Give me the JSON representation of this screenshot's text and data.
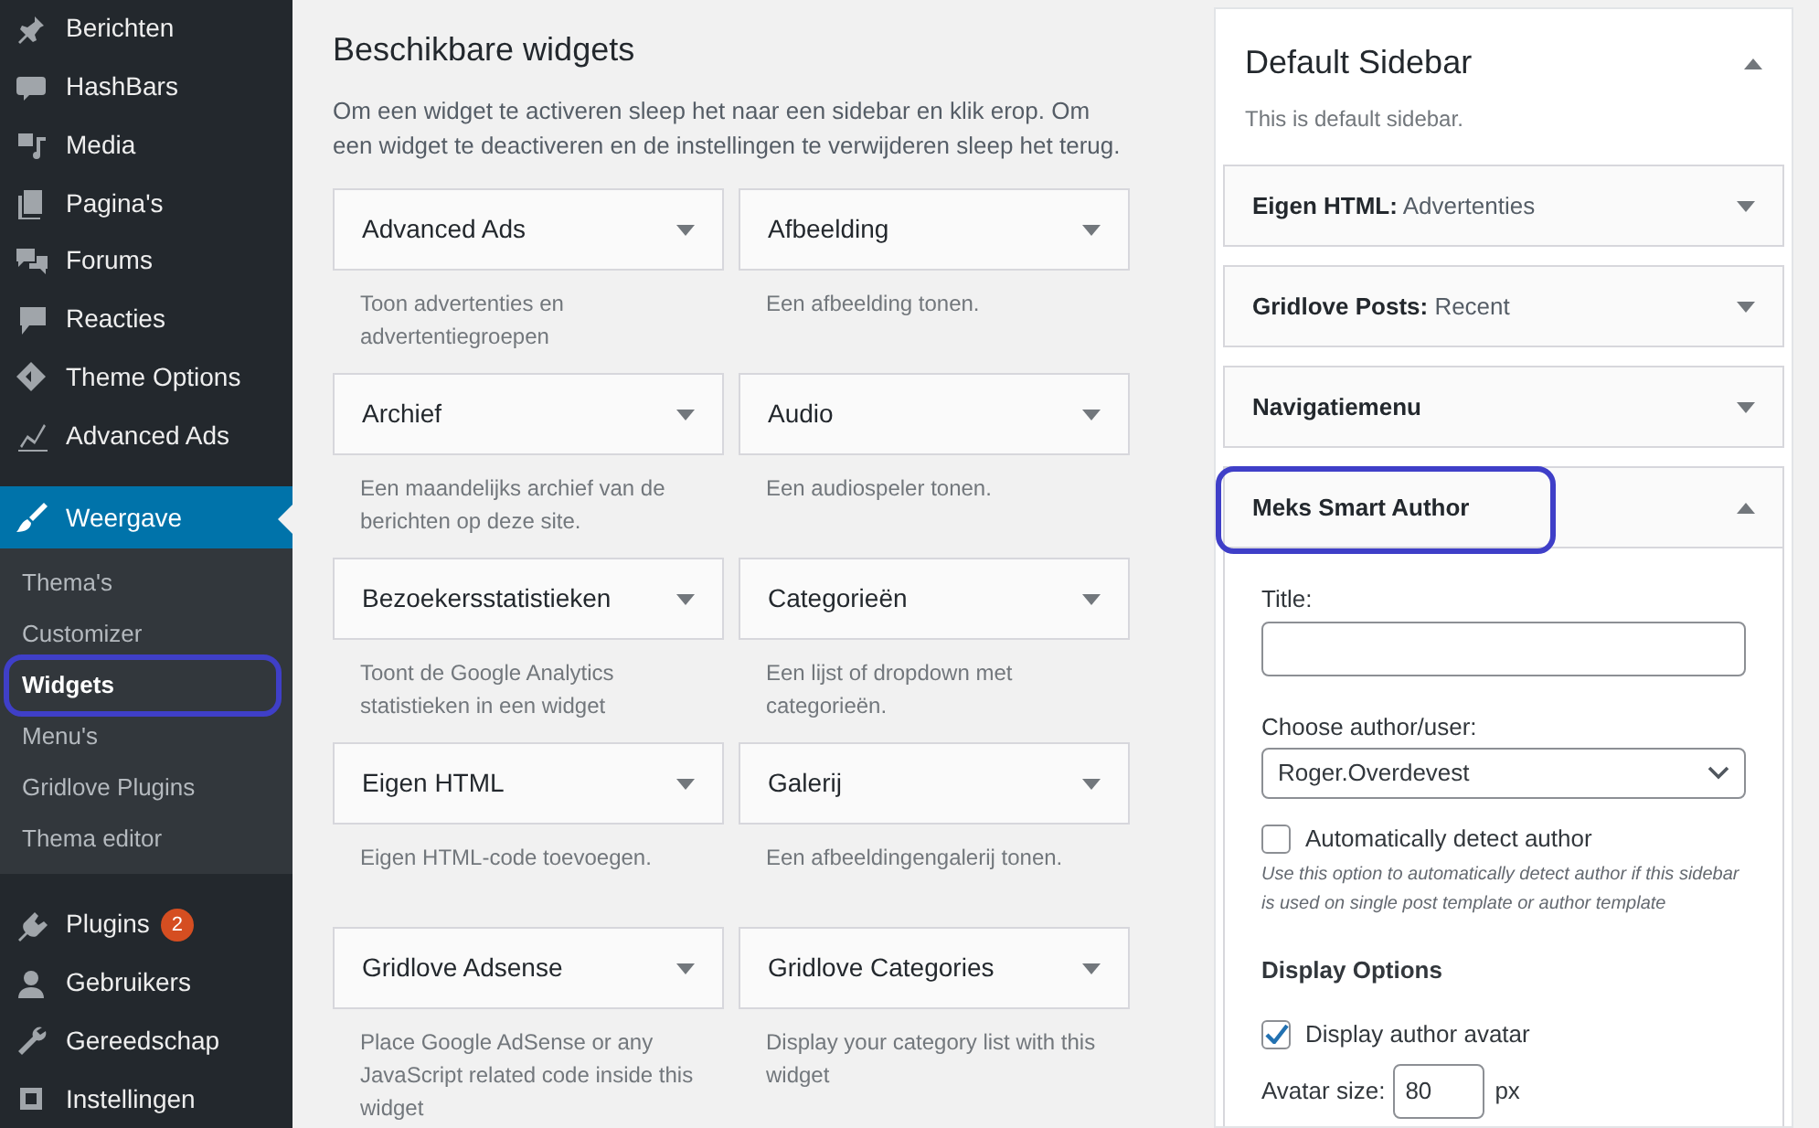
{
  "admin_menu": {
    "items": [
      {
        "label": "Berichten",
        "selected": false
      },
      {
        "label": "HashBars",
        "selected": false
      },
      {
        "label": "Media",
        "selected": false
      },
      {
        "label": "Pagina's",
        "selected": false
      },
      {
        "label": "Forums",
        "selected": false
      },
      {
        "label": "Reacties",
        "selected": false
      },
      {
        "label": "Theme Options",
        "selected": false
      },
      {
        "label": "Advanced Ads",
        "selected": false
      },
      {
        "label": "Weergave",
        "selected": true,
        "children": [
          {
            "label": "Thema's",
            "selected": false,
            "highlighted": false
          },
          {
            "label": "Customizer",
            "selected": false,
            "highlighted": false
          },
          {
            "label": "Widgets",
            "selected": true,
            "highlighted": true
          },
          {
            "label": "Menu's",
            "selected": false,
            "highlighted": false
          },
          {
            "label": "Gridlove Plugins",
            "selected": false,
            "highlighted": false
          },
          {
            "label": "Thema editor",
            "selected": false,
            "highlighted": false
          }
        ]
      },
      {
        "label": "Plugins",
        "selected": false,
        "badge": "2"
      },
      {
        "label": "Gebruikers",
        "selected": false
      },
      {
        "label": "Gereedschap",
        "selected": false
      },
      {
        "label": "Instellingen",
        "selected": false
      }
    ]
  },
  "available_widgets": {
    "title": "Beschikbare widgets",
    "description": "Om een widget te activeren sleep het naar een sidebar en klik erop. Om een widget te deactiveren en de instellingen te verwijderen sleep het terug.",
    "widgets": [
      {
        "title": "Advanced Ads",
        "description": "Toon advertenties en advertentiegroepen"
      },
      {
        "title": "Afbeelding",
        "description": "Een afbeelding tonen."
      },
      {
        "title": "Archief",
        "description": "Een maandelijks archief van de berichten op deze site."
      },
      {
        "title": "Audio",
        "description": "Een audiospeler tonen."
      },
      {
        "title": "Bezoekersstatistieken",
        "description": "Toont de Google Analytics statistieken in een widget"
      },
      {
        "title": "Categorieën",
        "description": "Een lijst of dropdown met categorieën."
      },
      {
        "title": "Eigen HTML",
        "description": "Eigen HTML-code toevoegen."
      },
      {
        "title": "Galerij",
        "description": "Een afbeeldingengalerij tonen."
      },
      {
        "title": "Gridlove Adsense",
        "description": "Place Google AdSense or any JavaScript related code inside this widget"
      },
      {
        "title": "Gridlove Categories",
        "description": "Display your category list with this widget"
      }
    ]
  },
  "sidebar_area": {
    "title": "Default Sidebar",
    "expanded": true,
    "description": "This is default sidebar.",
    "widgets": [
      {
        "title": "Eigen HTML:",
        "subtitle": "Advertenties",
        "expanded": false,
        "highlighted": false
      },
      {
        "title": "Gridlove Posts:",
        "subtitle": "Recent",
        "expanded": false,
        "highlighted": false
      },
      {
        "title": "Navigatiemenu",
        "expanded": false,
        "highlighted": false
      },
      {
        "title": "Meks Smart Author",
        "expanded": true,
        "highlighted": true,
        "form": {
          "title_label": "Title:",
          "author_label": "Choose author/user:",
          "author_value": "Roger.Overdevest",
          "auto_detect": {
            "label": "Automatically detect author",
            "checked": false,
            "hint": "Use this option to automatically detect author if this sidebar is used on single post template or author template"
          },
          "display_heading": "Display Options",
          "display_avatar": {
            "label": "Display author avatar",
            "checked": true
          },
          "avatar_size_label": "Avatar size:",
          "avatar_size_value": "80",
          "avatar_unit": "px"
        }
      }
    ]
  }
}
